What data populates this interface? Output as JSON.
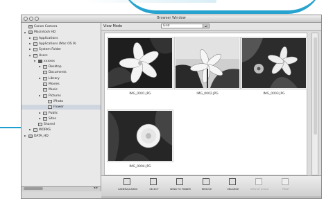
{
  "window": {
    "title": "Browser Window"
  },
  "sidebar": {
    "items": [
      {
        "label": "Canon Camera",
        "indent": 0,
        "icon": "camera-icon",
        "toggle": "none"
      },
      {
        "label": "Macintosh HD",
        "indent": 0,
        "icon": "drive-icon",
        "toggle": "open"
      },
      {
        "label": "Applications",
        "indent": 1,
        "icon": "folder-icon",
        "toggle": "closed"
      },
      {
        "label": "Applications (Mac OS 9)",
        "indent": 1,
        "icon": "folder-icon",
        "toggle": "closed"
      },
      {
        "label": "System Folder",
        "indent": 1,
        "icon": "folder-icon",
        "toggle": "closed"
      },
      {
        "label": "Users",
        "indent": 1,
        "icon": "folder-icon",
        "toggle": "open"
      },
      {
        "label": "xxxxxx",
        "indent": 2,
        "icon": "home-icon",
        "toggle": "open"
      },
      {
        "label": "Desktop",
        "indent": 3,
        "icon": "folder-icon",
        "toggle": "closed"
      },
      {
        "label": "Documents",
        "indent": 3,
        "icon": "folder-icon",
        "toggle": "none"
      },
      {
        "label": "Library",
        "indent": 3,
        "icon": "folder-icon",
        "toggle": "closed"
      },
      {
        "label": "Movies",
        "indent": 3,
        "icon": "folder-icon",
        "toggle": "none"
      },
      {
        "label": "Music",
        "indent": 3,
        "icon": "folder-icon",
        "toggle": "none"
      },
      {
        "label": "Pictures",
        "indent": 3,
        "icon": "folder-icon",
        "toggle": "open"
      },
      {
        "label": "iPhoto",
        "indent": 4,
        "icon": "folder-icon",
        "toggle": "none"
      },
      {
        "label": "Flower",
        "indent": 4,
        "icon": "folder-icon",
        "toggle": "none",
        "selected": true
      },
      {
        "label": "Public",
        "indent": 3,
        "icon": "folder-icon",
        "toggle": "closed"
      },
      {
        "label": "Sites",
        "indent": 3,
        "icon": "folder-icon",
        "toggle": "closed"
      },
      {
        "label": "Shared",
        "indent": 2,
        "icon": "folder-icon",
        "toggle": "none"
      },
      {
        "label": "WORKS",
        "indent": 1,
        "icon": "folder-icon",
        "toggle": "closed"
      },
      {
        "label": "DATA_HD",
        "indent": 0,
        "icon": "drive-icon",
        "toggle": "closed"
      }
    ]
  },
  "main": {
    "view_mode_label": "View Mode",
    "view_mode_value": "Grid"
  },
  "thumbnails": [
    {
      "caption": "IMG_0001.JPG"
    },
    {
      "caption": "IMG_0002.JPG"
    },
    {
      "caption": "IMG_0003.JPG"
    },
    {
      "caption": "IMG_0004.JPG"
    }
  ],
  "toolbar": {
    "buttons": [
      {
        "label": "CAMERA/CARDS",
        "icon": "camera-icon",
        "disabled": false
      },
      {
        "label": "SELECT",
        "icon": "select-icon",
        "disabled": false
      },
      {
        "label": "SEND TO FINDER",
        "icon": "send-icon",
        "disabled": false
      },
      {
        "label": "REDUCE",
        "icon": "zoom-out-icon",
        "disabled": false
      },
      {
        "label": "ENLARGE",
        "icon": "zoom-in-icon",
        "disabled": false
      },
      {
        "label": "VIEW AT SCALE",
        "icon": "view-icon",
        "disabled": true
      },
      {
        "label": "PRINT",
        "icon": "print-icon",
        "disabled": true
      }
    ]
  },
  "colors": {
    "accent": "#1ea0cf"
  }
}
